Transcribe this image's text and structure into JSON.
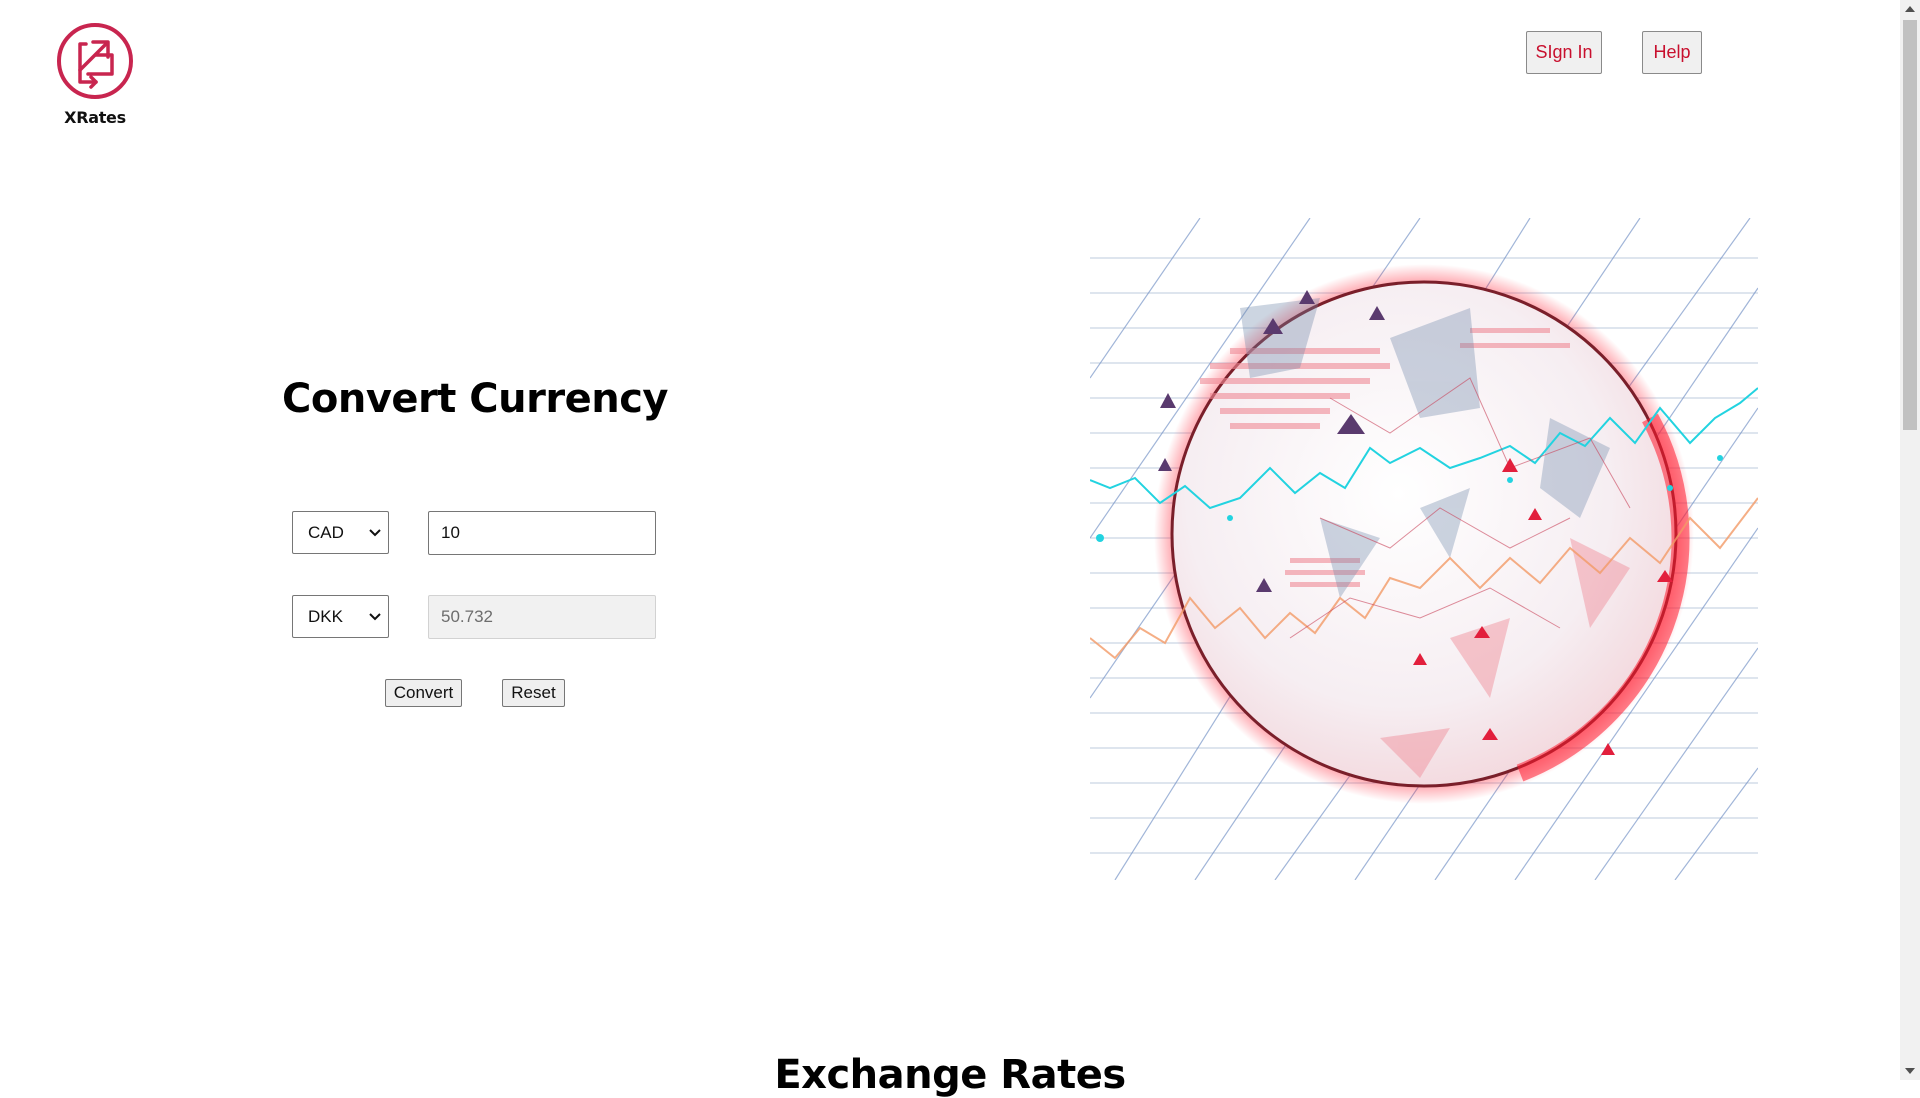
{
  "brand": {
    "name": "XRates",
    "color": "#c8254f"
  },
  "header": {
    "signin_label": "SIgn In",
    "help_label": "Help",
    "accent": "#c8102e"
  },
  "converter": {
    "title": "Convert Currency",
    "from_currency": "CAD",
    "to_currency": "DKK",
    "amount_value": "10",
    "result_value": "50.732",
    "convert_label": "Convert",
    "reset_label": "Reset"
  },
  "rates_section": {
    "title": "Exchange Rates"
  },
  "icons": {
    "logo": "exchange-arrows-icon",
    "select_chevron": "chevron-down-icon",
    "scroll_up": "scroll-up-arrow-icon",
    "scroll_down": "scroll-down-arrow-icon"
  }
}
